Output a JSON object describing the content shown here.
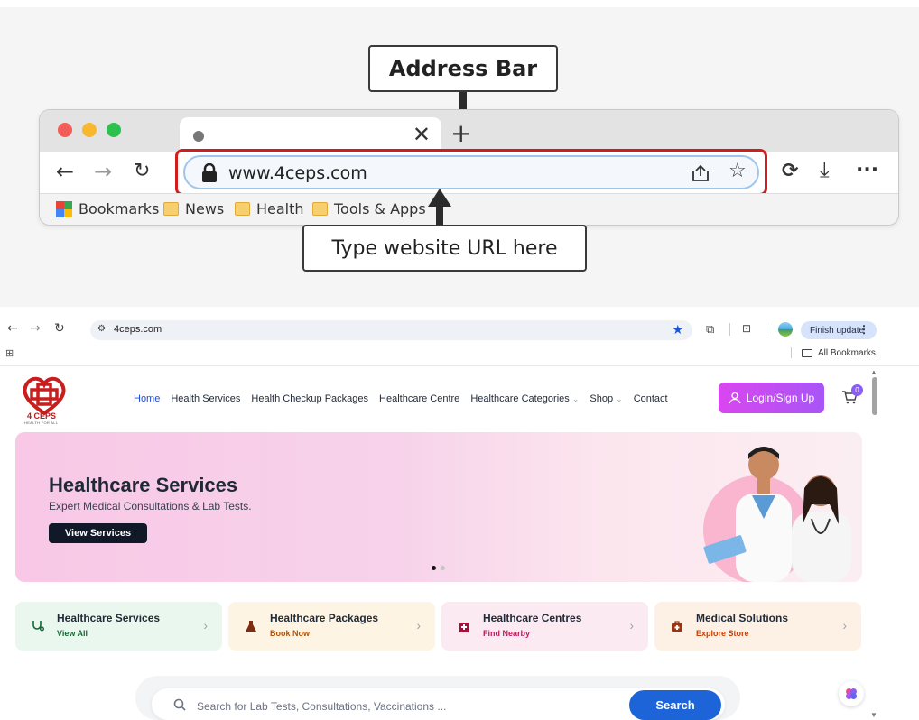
{
  "illustration": {
    "callout_top": "Address Bar",
    "callout_bottom": "Type website URL here",
    "url": "www.4ceps.com",
    "bookmarks": [
      "Bookmarks",
      "News",
      "Health",
      "Tools & Apps"
    ],
    "traffic_light_colors": [
      "#f25e57",
      "#f7b731",
      "#2ec04f"
    ]
  },
  "browser": {
    "url": "4ceps.com",
    "finish_update": "Finish update",
    "all_bookmarks": "All Bookmarks"
  },
  "site": {
    "logo_text": "4 CEPS",
    "logo_tagline": "HEALTH FOR ALL",
    "nav": {
      "home": "Home",
      "health_services": "Health Services",
      "packages": "Health Checkup Packages",
      "centre": "Healthcare Centre",
      "categories": "Healthcare Categories",
      "shop": "Shop",
      "contact": "Contact"
    },
    "login": "Login/Sign Up",
    "cart_count": "0",
    "hero": {
      "title": "Healthcare Services",
      "subtitle": "Expert Medical Consultations & Lab Tests.",
      "button": "View Services"
    },
    "cards": [
      {
        "title": "Healthcare Services",
        "sub": "View All",
        "bg": "#eaf7ee",
        "color": "#166534"
      },
      {
        "title": "Healthcare Packages",
        "sub": "Book Now",
        "bg": "#fdf4e3",
        "color": "#b45309"
      },
      {
        "title": "Healthcare Centres",
        "sub": "Find Nearby",
        "bg": "#fbeaf1",
        "color": "#be185d"
      },
      {
        "title": "Medical Solutions",
        "sub": "Explore Store",
        "bg": "#fdf1e5",
        "color": "#c2410c"
      }
    ],
    "search": {
      "placeholder": "Search for Lab Tests, Consultations, Vaccinations ...",
      "button": "Search"
    }
  }
}
